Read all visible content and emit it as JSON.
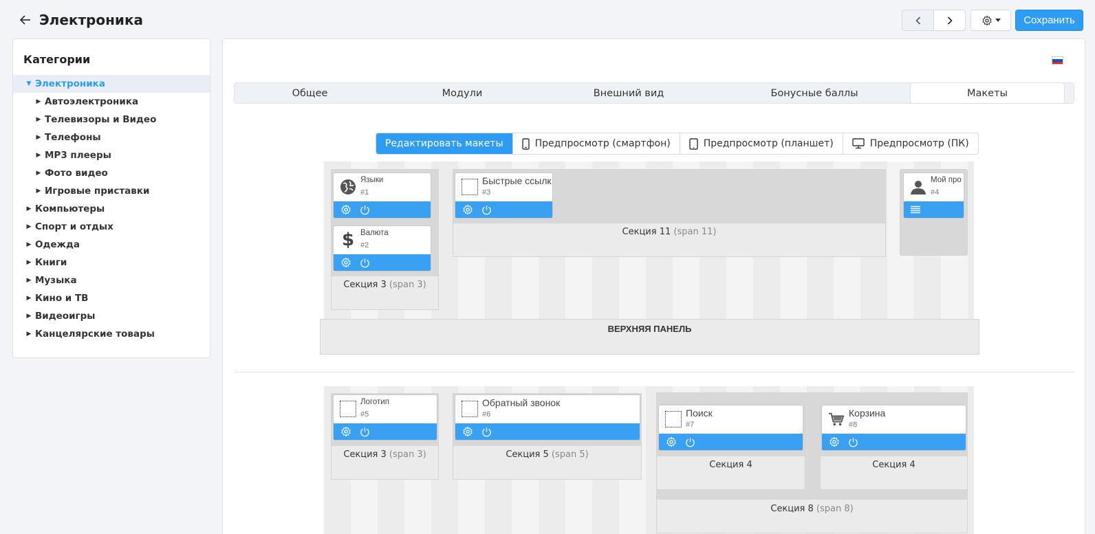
{
  "header": {
    "title": "Электроника",
    "save_label": "Сохранить"
  },
  "sidebar": {
    "title": "Категории",
    "items": [
      {
        "label": "Электроника",
        "level": 0,
        "expanded": true,
        "active": true
      },
      {
        "label": "Автоэлектроника",
        "level": 1
      },
      {
        "label": "Телевизоры и Видео",
        "level": 1
      },
      {
        "label": "Телефоны",
        "level": 1
      },
      {
        "label": "MP3 плееры",
        "level": 1
      },
      {
        "label": "Фото видео",
        "level": 1
      },
      {
        "label": "Игровые приставки",
        "level": 1
      },
      {
        "label": "Компьютеры",
        "level": 0
      },
      {
        "label": "Спорт и отдых",
        "level": 0
      },
      {
        "label": "Одежда",
        "level": 0
      },
      {
        "label": "Книги",
        "level": 0
      },
      {
        "label": "Музыка",
        "level": 0
      },
      {
        "label": "Кино и ТВ",
        "level": 0
      },
      {
        "label": "Видеоигры",
        "level": 0
      },
      {
        "label": "Канцелярские товары",
        "level": 0
      }
    ]
  },
  "tabs": [
    {
      "label": "Общее"
    },
    {
      "label": "Модули"
    },
    {
      "label": "Внешний вид"
    },
    {
      "label": "Бонусные баллы"
    },
    {
      "label": "Макеты",
      "active": true
    }
  ],
  "modes": [
    {
      "label": "Редактировать макеты",
      "active": true
    },
    {
      "label": "Предпросмотр (смартфон)",
      "icon": "smartphone-icon"
    },
    {
      "label": "Предпросмотр (планшет)",
      "icon": "tablet-icon"
    },
    {
      "label": "Предпросмотр (ПК)",
      "icon": "monitor-icon"
    }
  ],
  "modules": {
    "m1": {
      "name": "Языки",
      "id": "#1",
      "icon": "globe-icon"
    },
    "m2": {
      "name": "Валюта",
      "id": "#2",
      "icon": "dollar-icon"
    },
    "m3": {
      "name": "Быстрые ссылк",
      "id": "#3",
      "icon": "dotted-placeholder-icon"
    },
    "m4": {
      "name": "Мой про",
      "id": "#4",
      "icon": "user-icon"
    },
    "m5": {
      "name": "Логотип",
      "id": "#5",
      "icon": "dotted-placeholder-icon"
    },
    "m6": {
      "name": "Обратный звонок",
      "id": "#6",
      "icon": "dotted-placeholder-icon"
    },
    "m7": {
      "name": "Поиск",
      "id": "#7",
      "icon": "dotted-placeholder-icon"
    },
    "m8": {
      "name": "Корзина",
      "id": "#8",
      "icon": "cart-icon"
    }
  },
  "sections": {
    "s_top_left": {
      "name": "Секция 3",
      "span": "(span 3)"
    },
    "s_top_mid": {
      "name": "Секция 11",
      "span": "(span 11)"
    },
    "top_panel": "ВЕРХНЯЯ ПАНЕЛЬ",
    "s_bot_1": {
      "name": "Секция 3",
      "span": "(span 3)"
    },
    "s_bot_2": {
      "name": "Секция 5",
      "span": "(span 5)"
    },
    "s_bot_3a": {
      "name": "Секция 4"
    },
    "s_bot_3b": {
      "name": "Секция 4"
    },
    "s_bot_3": {
      "name": "Секция 8",
      "span": "(span 8)"
    }
  },
  "colors": {
    "accent": "#2f9cf4",
    "module_bar": "#39a0f2"
  }
}
